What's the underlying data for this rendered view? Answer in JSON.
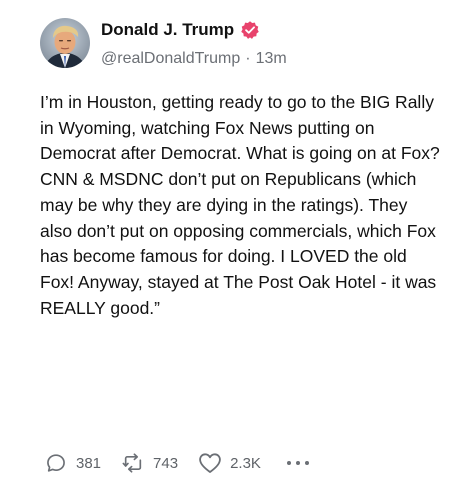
{
  "post": {
    "author": {
      "display_name": "Donald J. Trump",
      "handle": "@realDonaldTrump",
      "verified": true,
      "verified_badge_color": "#e8436c"
    },
    "separator": "·",
    "time_ago": "13m",
    "text": "I’m in Houston, getting ready to go to the BIG Rally in Wyoming, watching Fox News putting on Democrat after Democrat. What is going on at Fox? CNN & MSDNC don’t put on Republicans (which may be why they are dying in the ratings). They also don’t put on opposing commercials, which Fox has become famous for doing. I LOVED the old Fox! Anyway, stayed at The Post Oak Hotel - it was REALLY good.”",
    "actions": {
      "replies": {
        "icon": "reply-icon",
        "count": "381"
      },
      "reposts": {
        "icon": "repost-icon",
        "count": "743"
      },
      "likes": {
        "icon": "heart-icon",
        "count": "2.3K"
      },
      "more": {
        "icon": "more-icon"
      }
    }
  }
}
